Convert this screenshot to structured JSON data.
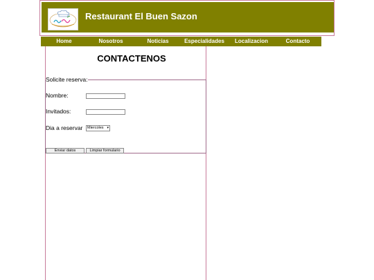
{
  "header": {
    "title": "Restaurant El Buen Sazon",
    "logo_icon": "restaurant-logo-chef-hat",
    "colors": {
      "bar": "#808000",
      "border": "#c77a9a"
    }
  },
  "nav": {
    "items": [
      {
        "label": "Home"
      },
      {
        "label": "Nosotros"
      },
      {
        "label": "Noticias"
      },
      {
        "label": "Especialidades"
      },
      {
        "label": "Localizacion"
      },
      {
        "label": "Contacto"
      }
    ]
  },
  "main": {
    "title": "CONTACTENOS",
    "form": {
      "legend": "Solicite reserva:",
      "fields": [
        {
          "label": "Nombre:",
          "value": ""
        },
        {
          "label": "Invitados:",
          "value": ""
        }
      ],
      "day": {
        "label": "Dia a reservar",
        "selected": "Miercoles"
      },
      "buttons": {
        "submit": "Enviar datos",
        "reset": "Limpiar formulario"
      }
    }
  }
}
